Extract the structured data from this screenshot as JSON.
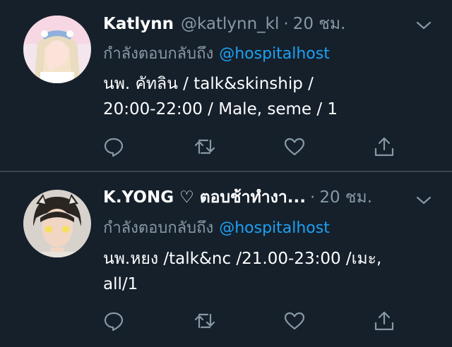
{
  "tweets": [
    {
      "author_name": "Katlynn",
      "handle": "@katlynn_kl",
      "separator": "·",
      "time": "20 ชม.",
      "reply_prefix": "กำลังตอบกลับถึง",
      "reply_mention": "@hospitalhost",
      "body_lines": [
        "นพ. คัทลิน / talk&skinship /",
        "20:00-22:00 / Male, seme / 1"
      ]
    },
    {
      "author_name": "K.YONG  ♡ ตอบช้าทำงา...",
      "separator": "·",
      "time": "20 ชม.",
      "reply_prefix": "กำลังตอบกลับถึง",
      "reply_mention": "@hospitalhost",
      "body_lines": [
        "นพ.หยง /talk&nc /21.00-23:00 /เมะ,",
        "all/1"
      ]
    }
  ],
  "icons": {
    "reply": "reply-icon",
    "retweet": "retweet-icon",
    "like": "heart-icon",
    "share": "share-icon",
    "more": "chevron-down-icon"
  },
  "colors": {
    "background": "#15202b",
    "secondary_text": "#8899a6",
    "link": "#1da1f2",
    "divider": "#38444d"
  }
}
